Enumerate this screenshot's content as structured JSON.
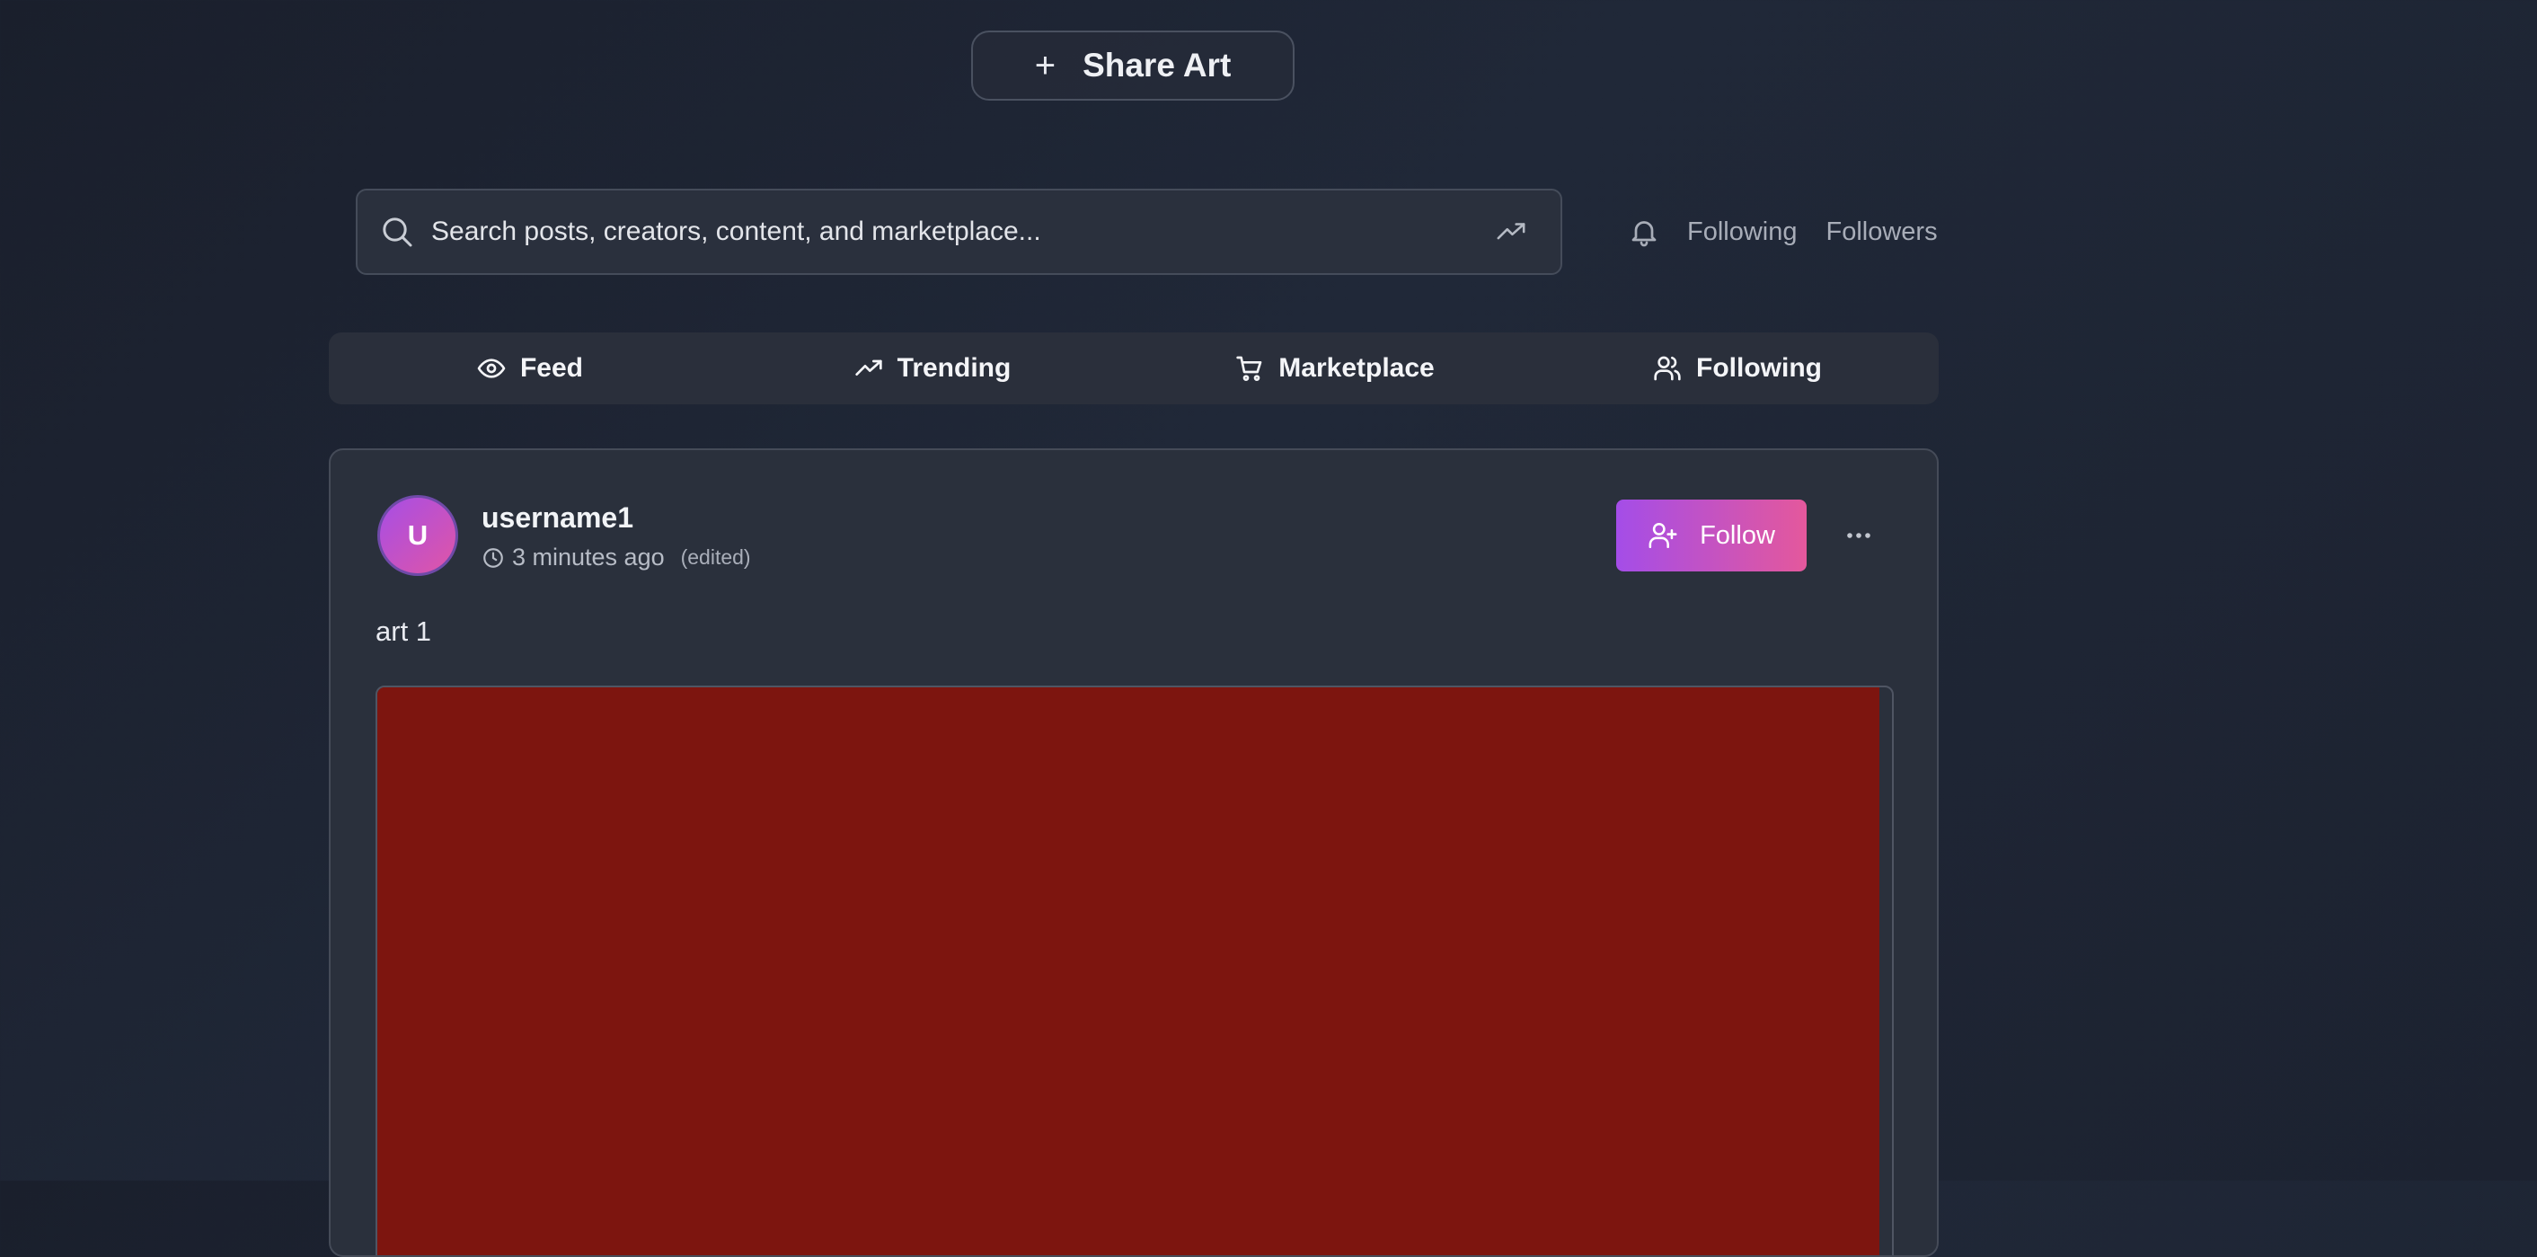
{
  "header": {
    "share_button_label": "Share Art"
  },
  "search": {
    "placeholder": "Search posts, creators, content, and marketplace..."
  },
  "top_links": {
    "following": "Following",
    "followers": "Followers"
  },
  "tabs": [
    {
      "label": "Feed",
      "icon": "eye-icon"
    },
    {
      "label": "Trending",
      "icon": "trending-icon"
    },
    {
      "label": "Marketplace",
      "icon": "cart-icon"
    },
    {
      "label": "Following",
      "icon": "users-icon"
    }
  ],
  "post": {
    "avatar_initial": "U",
    "username": "username1",
    "time_ago": "3 minutes ago",
    "edited_label": "(edited)",
    "follow_label": "Follow",
    "caption": "art 1",
    "art_color": "#7d150f"
  },
  "colors": {
    "accent_start": "#a44de8",
    "accent_end": "#e4589c",
    "background": "#1f2533"
  }
}
